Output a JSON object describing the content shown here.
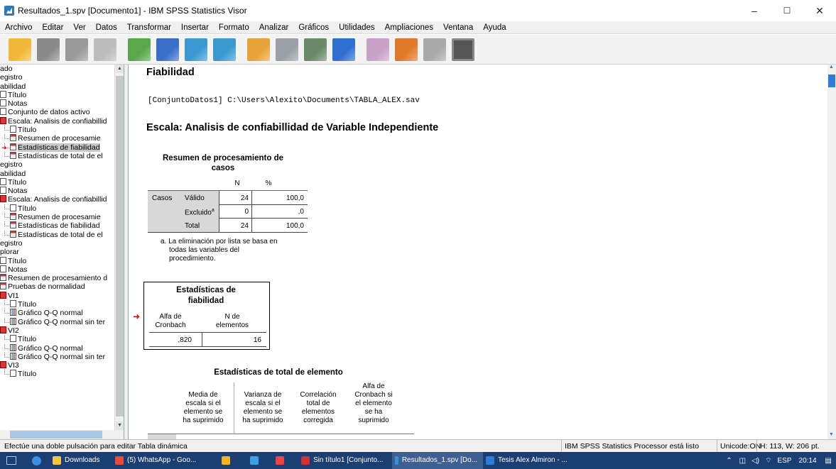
{
  "window": {
    "title": "Resultados_1.spv [Documento1] - IBM SPSS Statistics Visor",
    "min": "–",
    "max": "☐",
    "close": "✕"
  },
  "menu": [
    "Archivo",
    "Editar",
    "Ver",
    "Datos",
    "Transformar",
    "Insertar",
    "Formato",
    "Analizar",
    "Gráficos",
    "Utilidades",
    "Ampliaciones",
    "Ventana",
    "Ayuda"
  ],
  "toolbar_icons": [
    "open-folder-icon",
    "save-icon",
    "print-icon",
    "print-preview-icon",
    "export-icon",
    "recall-dialog-icon",
    "undo-icon",
    "redo-icon",
    "goto-data-icon",
    "goto-case-icon",
    "goto-variable-icon",
    "variables-icon",
    "designate-window-icon",
    "script-icon",
    "show-hide-icon",
    "insert-icon"
  ],
  "tree": [
    {
      "t": "ado",
      "icon": "",
      "ind": 0
    },
    {
      "t": "egistro",
      "icon": "",
      "ind": 0
    },
    {
      "t": "abilidad",
      "icon": "",
      "ind": 0
    },
    {
      "t": "Título",
      "icon": "doc",
      "ind": 0
    },
    {
      "t": "Notas",
      "icon": "doc",
      "ind": 0
    },
    {
      "t": "Conjunto de datos activo",
      "icon": "doc",
      "ind": 0
    },
    {
      "t": "Escala: Analisis de confiabillid",
      "icon": "book",
      "ind": 0
    },
    {
      "t": "Título",
      "icon": "doc",
      "ind": 1
    },
    {
      "t": "Resumen de procesamie",
      "icon": "tab",
      "ind": 1
    },
    {
      "t": "Estadísticas de fiabilidad",
      "icon": "tab",
      "ind": 1,
      "sel": true
    },
    {
      "t": "Estadísticas de total de el",
      "icon": "tab",
      "ind": 1
    },
    {
      "t": "egistro",
      "icon": "",
      "ind": 0
    },
    {
      "t": "abilidad",
      "icon": "",
      "ind": 0
    },
    {
      "t": "Título",
      "icon": "doc",
      "ind": 0
    },
    {
      "t": "Notas",
      "icon": "doc",
      "ind": 0
    },
    {
      "t": "Escala: Analisis de confiabillid",
      "icon": "book",
      "ind": 0
    },
    {
      "t": "Título",
      "icon": "doc",
      "ind": 1
    },
    {
      "t": "Resumen de procesamie",
      "icon": "tab",
      "ind": 1
    },
    {
      "t": "Estadísticas de fiabilidad",
      "icon": "tab",
      "ind": 1
    },
    {
      "t": "Estadísticas de total de el",
      "icon": "tab",
      "ind": 1
    },
    {
      "t": "egistro",
      "icon": "",
      "ind": 0
    },
    {
      "t": "plorar",
      "icon": "",
      "ind": 0
    },
    {
      "t": "Título",
      "icon": "doc",
      "ind": 0
    },
    {
      "t": "Notas",
      "icon": "doc",
      "ind": 0
    },
    {
      "t": "Resumen de procesamiento d",
      "icon": "tab",
      "ind": 0
    },
    {
      "t": "Pruebas de normalidad",
      "icon": "tab",
      "ind": 0
    },
    {
      "t": "VI1",
      "icon": "book",
      "ind": 0
    },
    {
      "t": "Título",
      "icon": "doc",
      "ind": 1
    },
    {
      "t": "Gráfico Q-Q normal",
      "icon": "chart",
      "ind": 1
    },
    {
      "t": "Gráfico Q-Q normal sin ter",
      "icon": "chart",
      "ind": 1
    },
    {
      "t": "VI2",
      "icon": "book",
      "ind": 0
    },
    {
      "t": "Título",
      "icon": "doc",
      "ind": 1
    },
    {
      "t": "Gráfico Q-Q normal",
      "icon": "chart",
      "ind": 1
    },
    {
      "t": "Gráfico Q-Q normal sin ter",
      "icon": "chart",
      "ind": 1
    },
    {
      "t": "VI3",
      "icon": "book",
      "ind": 0
    },
    {
      "t": "Título",
      "icon": "doc",
      "ind": 1
    }
  ],
  "output": {
    "heading": "Fiabilidad",
    "dataset_line": "[ConjuntoDatos1] C:\\Users\\Alexito\\Documents\\TABLA_ALEX.sav",
    "scale_heading": "Escala: Analisis de confiabillidad de Variable Independiente",
    "case_summary": {
      "title1": "Resumen de procesamiento de",
      "title2": "casos",
      "col_n": "N",
      "col_pct": "%",
      "row_group": "Casos",
      "rows": [
        {
          "label": "Válido",
          "n": "24",
          "pct": "100,0"
        },
        {
          "label": "Excluido",
          "sup": "a",
          "n": "0",
          "pct": ",0"
        },
        {
          "label": "Total",
          "n": "24",
          "pct": "100,0"
        }
      ],
      "footnote1": "a. La eliminación por lista se basa en",
      "footnote2": "todas las variables del",
      "footnote3": "procedimiento."
    },
    "reliability": {
      "title1": "Estadísticas de",
      "title2": "fiabilidad",
      "col1a": "Alfa de",
      "col1b": "Cronbach",
      "col2a": "N de",
      "col2b": "elementos",
      "alpha": ",820",
      "n": "16"
    },
    "item_total": {
      "title": "Estadísticas de total de elemento",
      "cols": [
        [
          "",
          "Media de",
          "escala si el",
          "elemento se",
          "ha suprimido"
        ],
        [
          "",
          "Varianza de",
          "escala si el",
          "elemento se",
          "ha suprimido"
        ],
        [
          "",
          "Correlación",
          "total de",
          "elementos",
          "corregida"
        ],
        [
          "Alfa de",
          "Cronbach si",
          "el elemento",
          "se ha",
          "suprimido"
        ]
      ]
    }
  },
  "status": {
    "left": "Efectúe una doble pulsación para editar Tabla dinámica",
    "processor": "IBM SPSS Statistics Processor está listo",
    "unicode": "Unicode:ON",
    "dims": "H: 113, W: 206 pt."
  },
  "taskbar": {
    "items": [
      {
        "label": "Downloads",
        "color": "#f4c542"
      },
      {
        "label": "(5) WhatsApp - Goo...",
        "color": "#e84c3d"
      },
      {
        "label": "",
        "color": "#f2b61c"
      },
      {
        "label": "",
        "color": "#3aa0e6"
      },
      {
        "label": "",
        "color": "#e44"
      },
      {
        "label": "Sin título1 [Conjunto...",
        "color": "#cc3333"
      },
      {
        "label": "Resultados_1.spv [Do...",
        "color": "#3a8fd8",
        "active": true
      },
      {
        "label": "Tesis Alex Almiron - ...",
        "color": "#2f7bd8"
      }
    ],
    "lang": "ESP",
    "time": "20:14"
  },
  "accent": "#2f7bd8"
}
